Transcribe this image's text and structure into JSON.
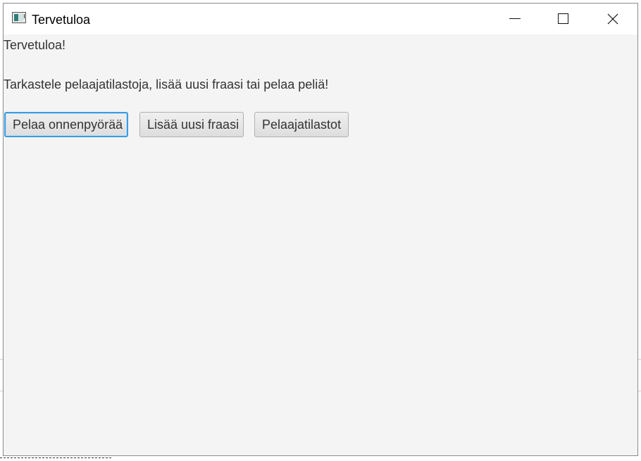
{
  "window": {
    "title": "Tervetuloa",
    "controls": {
      "minimize": "minimize-icon",
      "maximize": "maximize-icon",
      "close": "close-icon"
    }
  },
  "main": {
    "welcome": "Tervetuloa!",
    "instructions": "Tarkastele pelaajatilastoja, lisää uusi fraasi tai pelaa peliä!",
    "buttons": {
      "play": "Pelaa onnenpyörää",
      "add_phrase": "Lisää uusi fraasi",
      "player_stats": "Pelaajatilastot"
    }
  },
  "colors": {
    "window_background": "#f4f4f4",
    "titlebar_background": "#ffffff",
    "focus_border": "#3b9be0"
  }
}
